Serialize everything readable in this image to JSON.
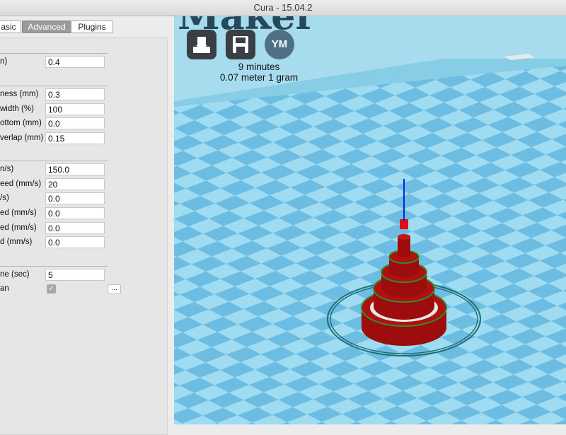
{
  "window": {
    "title": "Cura - 15.04.2"
  },
  "tabs": [
    {
      "label": "asic",
      "active": false
    },
    {
      "label": "Advanced",
      "active": true
    },
    {
      "label": "Plugins",
      "active": false
    }
  ],
  "settings": {
    "nozzle": {
      "label": "n)",
      "value": "0.4"
    },
    "first_layer_thickness": {
      "label": "ness (mm)",
      "value": "0.3"
    },
    "first_layer_width": {
      "label": "width (%)",
      "value": "100"
    },
    "cut_off_bottom": {
      "label": "ottom (mm)",
      "value": "0.0"
    },
    "dual_overlap": {
      "label": "verlap (mm)",
      "value": "0.15"
    },
    "travel_speed": {
      "label": "n/s)",
      "value": "150.0"
    },
    "bottom_layer_speed": {
      "label": "eed (mm/s)",
      "value": "20"
    },
    "infill_speed": {
      "label": "/s)",
      "value": "0.0"
    },
    "top_bottom_speed": {
      "label": "ed (mm/s)",
      "value": "0.0"
    },
    "outer_shell_speed": {
      "label": "ed (mm/s)",
      "value": "0.0"
    },
    "inner_shell_speed": {
      "label": "d (mm/s)",
      "value": "0.0"
    },
    "min_layer_time": {
      "label": "ne (sec)",
      "value": "5"
    },
    "cooling_fan": {
      "label": "an",
      "checked": true,
      "check_glyph": "✓",
      "more_label": "..."
    }
  },
  "viewport": {
    "backdrop_text": "Maker",
    "print_time": "9 minutes",
    "print_material": "0.07 meter 1 gram",
    "toolbar": [
      {
        "name": "load-model",
        "icon": "load-model-icon"
      },
      {
        "name": "save-toolpath",
        "icon": "floppy-disk-icon"
      },
      {
        "name": "youmagine",
        "icon": "youmagine-icon",
        "label": "YM"
      }
    ],
    "colors": {
      "floor_light": "#9fdcf2",
      "floor_dark": "#6dbde2",
      "model_red": "#9e0d0d",
      "model_green": "#2f8f2f",
      "skirt": "#1f6f73"
    }
  }
}
